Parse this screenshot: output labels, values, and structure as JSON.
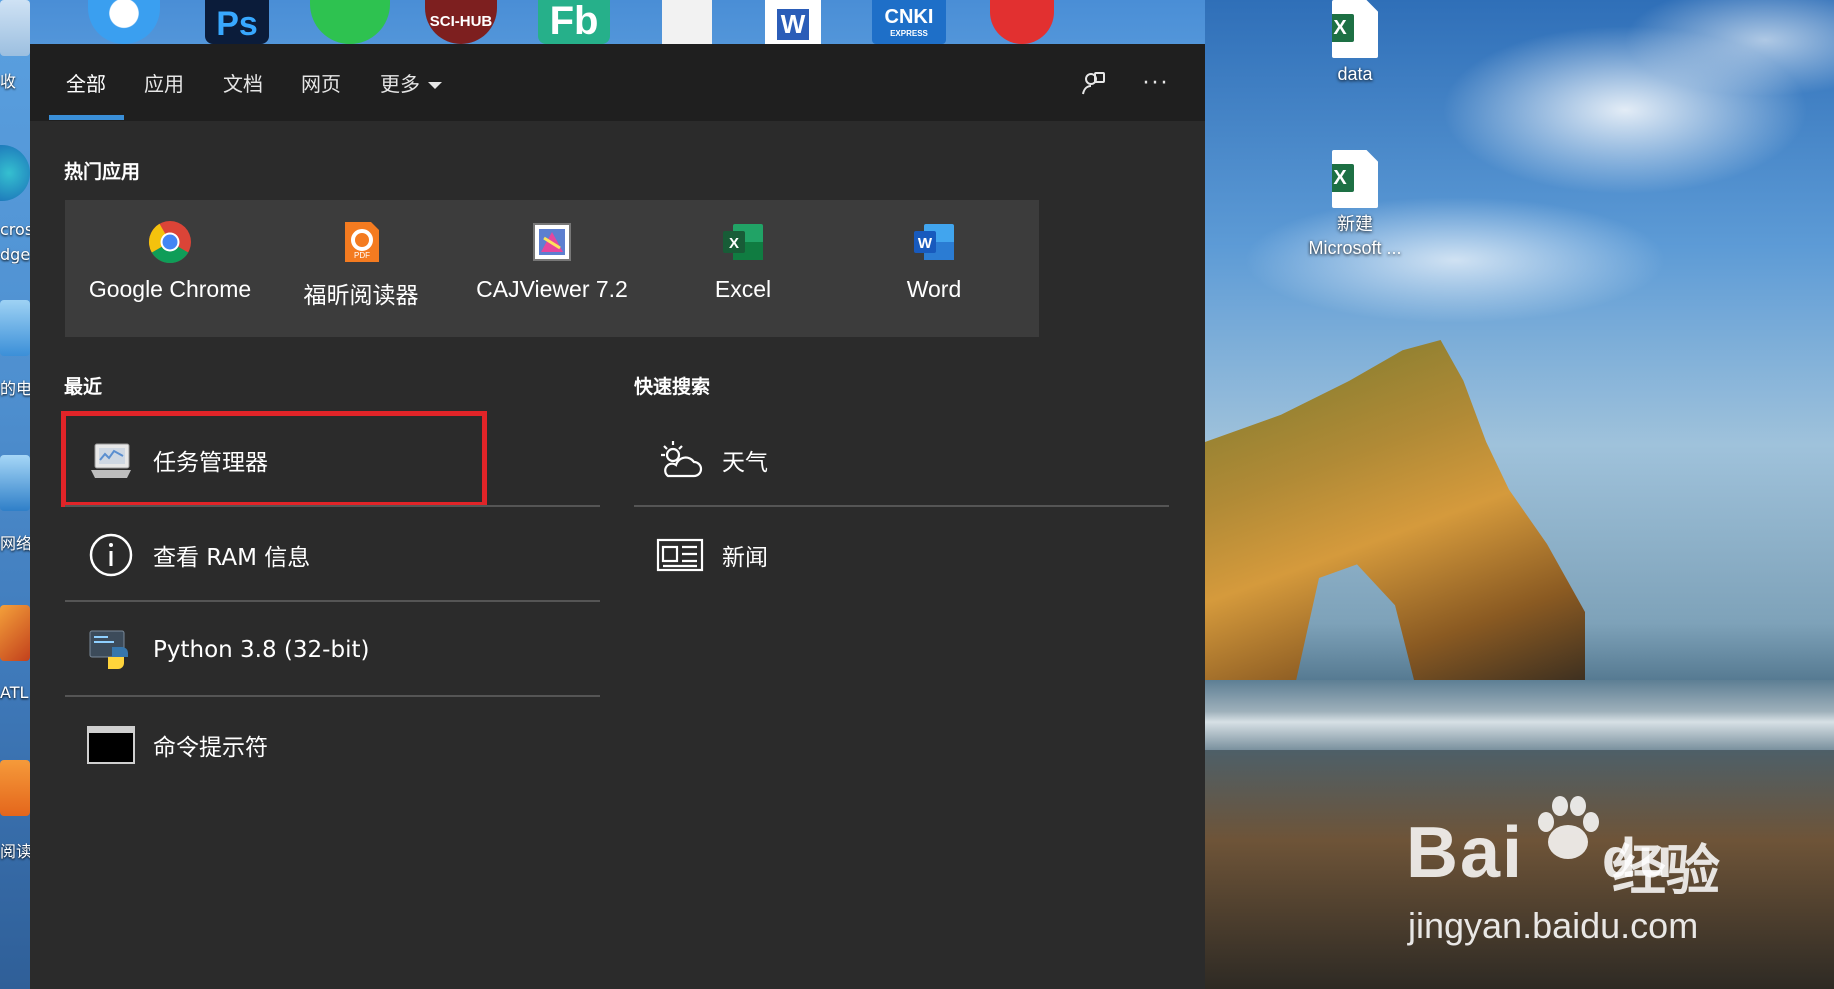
{
  "search_panel": {
    "tabs": [
      {
        "label": "全部",
        "active": true
      },
      {
        "label": "应用"
      },
      {
        "label": "文档"
      },
      {
        "label": "网页"
      },
      {
        "label": "更多"
      }
    ],
    "header_icons": [
      "feedback-icon",
      "more-options-icon"
    ],
    "top_apps": {
      "title": "热门应用",
      "items": [
        {
          "label": "Google Chrome",
          "icon": "chrome-icon"
        },
        {
          "label": "福昕阅读器",
          "icon": "foxit-pdf-icon"
        },
        {
          "label": "CAJViewer 7.2",
          "icon": "cajviewer-icon"
        },
        {
          "label": "Excel",
          "icon": "excel-icon"
        },
        {
          "label": "Word",
          "icon": "word-icon"
        }
      ]
    },
    "recent": {
      "title": "最近",
      "items": [
        {
          "label": "任务管理器",
          "icon": "task-manager-icon",
          "highlighted": true
        },
        {
          "label": "查看 RAM 信息",
          "icon": "info-icon"
        },
        {
          "label": "Python 3.8 (32-bit)",
          "icon": "python-icon"
        },
        {
          "label": "命令提示符",
          "icon": "command-prompt-icon"
        }
      ]
    },
    "quick_search": {
      "title": "快速搜索",
      "items": [
        {
          "label": "天气",
          "icon": "weather-icon"
        },
        {
          "label": "新闻",
          "icon": "news-icon"
        }
      ]
    }
  },
  "desktop": {
    "icons": [
      {
        "label": "data",
        "icon": "excel-file-icon"
      },
      {
        "label_line1": "新建",
        "label_line2": "Microsoft ...",
        "icon": "excel-file-icon"
      }
    ],
    "left_partial_labels": [
      "收",
      "cros",
      "dge",
      "的电",
      "网络",
      "ATL",
      "阅读"
    ],
    "top_taskbar_icons": [
      "feishu-icon",
      "photoshop-icon",
      "wechat-icon",
      "scihub-icon",
      "fb-icon",
      "file-icon",
      "word-doc-icon",
      "cnki-icon",
      "bird-icon"
    ],
    "top_icon_text": {
      "ps": "Ps",
      "scihub": "SCI-HUB",
      "fb": "Fb",
      "cnki": "CNKI",
      "cnki_sub": "EXPRESS"
    }
  },
  "watermark": {
    "brand": "Bai",
    "brand_suffix": "du",
    "chinese": "经验",
    "url": "jingyan.baidu.com"
  },
  "colors": {
    "panel_bg": "#2b2b2b",
    "header_bg": "#1f1f1f",
    "tile_bg": "#3c3c3c",
    "accent": "#3a8fd8",
    "highlight": "#e12428"
  }
}
